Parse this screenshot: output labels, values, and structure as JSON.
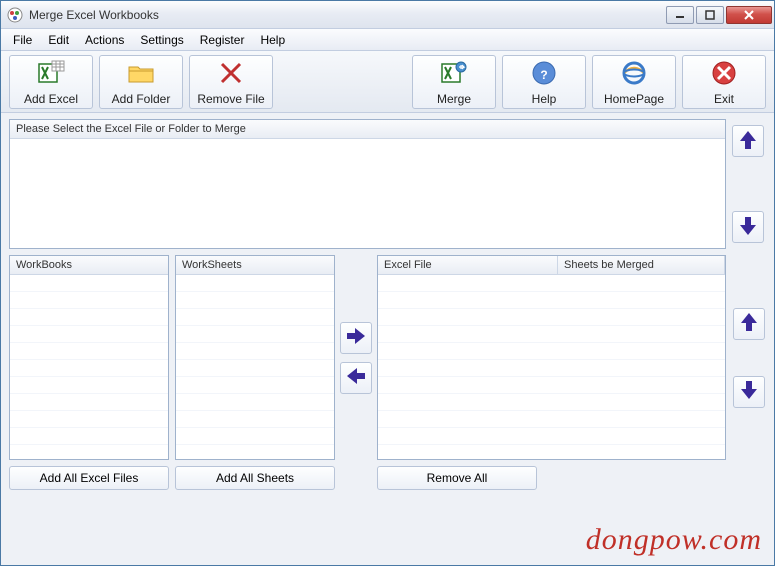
{
  "window": {
    "title": "Merge Excel Workbooks"
  },
  "menu": {
    "file": "File",
    "edit": "Edit",
    "actions": "Actions",
    "settings": "Settings",
    "register": "Register",
    "help": "Help"
  },
  "toolbar": {
    "add_excel": "Add Excel",
    "add_folder": "Add Folder",
    "remove_file": "Remove File",
    "merge": "Merge",
    "help": "Help",
    "homepage": "HomePage",
    "exit": "Exit"
  },
  "panes": {
    "select_prompt": "Please Select the Excel File or Folder to Merge",
    "workbooks": "WorkBooks",
    "worksheets": "WorkSheets",
    "excel_file": "Excel File",
    "sheets_merged": "Sheets be Merged"
  },
  "buttons": {
    "add_all_excel": "Add All Excel Files",
    "add_all_sheets": "Add All Sheets",
    "remove_all": "Remove All"
  },
  "watermark": "dongpow.com"
}
